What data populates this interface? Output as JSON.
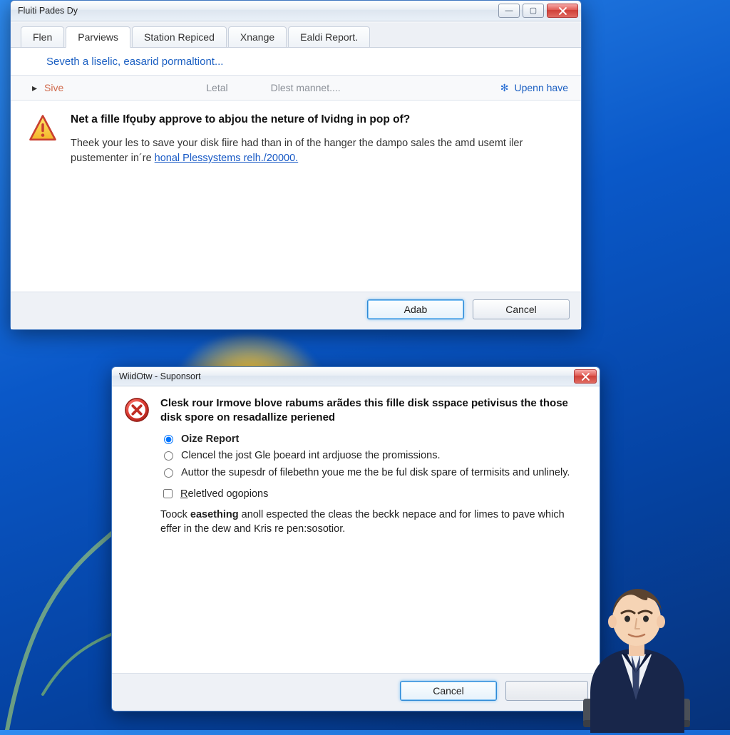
{
  "window1": {
    "title": "Fluiti Pades Dy",
    "tabs": [
      "Flen",
      "Parviews",
      "Station Repiced",
      "Xnange",
      "Ealdi Report."
    ],
    "activeTab": 1,
    "blueHeader": "Seveth a liselic, easarid pormaltiont...",
    "sive": "Sive",
    "letal": "Letal",
    "dlest": "Dlest mannet....",
    "upenn": "Upenn have",
    "heading": "Net a fille Ifǫuby approve to abjou the neture of Ividng in pop of?",
    "para_pre": "Theek your les to save your disk fiire had than in of the hanger the dampo sales the amd usemt iler pustementer in´re ",
    "para_link": "honal Plessystems relh./20000.",
    "buttons": {
      "ok": "Adab",
      "cancel": "Cancel"
    }
  },
  "window2": {
    "title": "WiidOtw - Suponsort",
    "heading": "Clesk rour Irmove blove rabums arãdes this fille disk sspace petivisus the those disk spore on resadallize periened",
    "options": [
      "Oize Report",
      "Clencel the jost Gle þoeard int ardjuose the promissions.",
      "Auttor the supesdr of filebethn youe me the be ful disk spare of termisits and unlinely."
    ],
    "checkbox_pre": "R",
    "checkbox_rest": "eletlved ogopions",
    "note_pre": "Toock ",
    "note_bold": "easething",
    "note_rest": " anoll espected the cleas the beckk nepace and for limes to pave which effer in the dew and Kris re pen:sosotior.",
    "cancel": "Cancel"
  },
  "colors": {
    "link": "#1658c5",
    "accent": "#2f8ad6",
    "error": "#cf3a30",
    "warn1": "#e13c34",
    "warn2": "#f6e36a"
  }
}
